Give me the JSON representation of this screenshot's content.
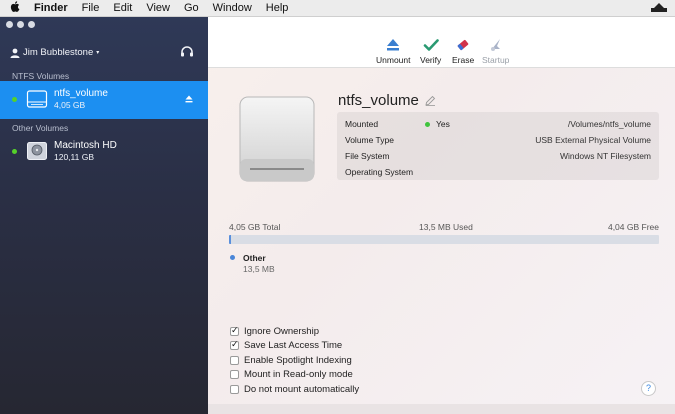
{
  "menubar": {
    "app": "Finder",
    "items": [
      "File",
      "Edit",
      "View",
      "Go",
      "Window",
      "Help"
    ]
  },
  "sidebar": {
    "user_name": "Jim Bubblestone",
    "sections": [
      {
        "label": "NTFS Volumes",
        "volumes": [
          {
            "name": "ntfs_volume",
            "size": "4,05 GB"
          }
        ]
      },
      {
        "label": "Other Volumes",
        "volumes": [
          {
            "name": "Macintosh HD",
            "size": "120,11 GB"
          }
        ]
      }
    ]
  },
  "toolbar": {
    "unmount": "Unmount",
    "verify": "Verify",
    "erase": "Erase",
    "startup": "Startup"
  },
  "volume": {
    "title": "ntfs_volume",
    "info": {
      "mounted_label": "Mounted",
      "mounted_value": "Yes",
      "mount_path": "/Volumes/ntfs_volume",
      "volume_type_label": "Volume Type",
      "volume_type_value": "USB External Physical Volume",
      "file_system_label": "File System",
      "file_system_value": "Windows NT Filesystem",
      "os_label": "Operating System"
    },
    "usage": {
      "total": "4,05 GB Total",
      "used": "13,5 MB Used",
      "free": "4,04 GB Free",
      "used_fraction": 0.0033,
      "legend_name": "Other",
      "legend_size": "13,5 MB"
    }
  },
  "options": [
    {
      "label": "Ignore Ownership",
      "checked": true
    },
    {
      "label": "Save Last Access Time",
      "checked": true
    },
    {
      "label": "Enable Spotlight Indexing",
      "checked": false
    },
    {
      "label": "Mount in Read-only mode",
      "checked": false
    },
    {
      "label": "Do not mount automatically",
      "checked": false
    }
  ],
  "help": "?",
  "colors": {
    "accent": "#1c8ff1",
    "sidebar": "#2f3957",
    "status_green": "#55d12a",
    "link": "#1c7ae0",
    "usage": "#5a8fdc"
  },
  "icons": [
    "apple-icon",
    "menubar-extra-icon",
    "user-icon",
    "headset-icon",
    "disk-icon",
    "eject-icon",
    "unmount-icon",
    "verify-icon",
    "erase-icon",
    "startup-icon",
    "pencil-icon",
    "help-icon"
  ]
}
